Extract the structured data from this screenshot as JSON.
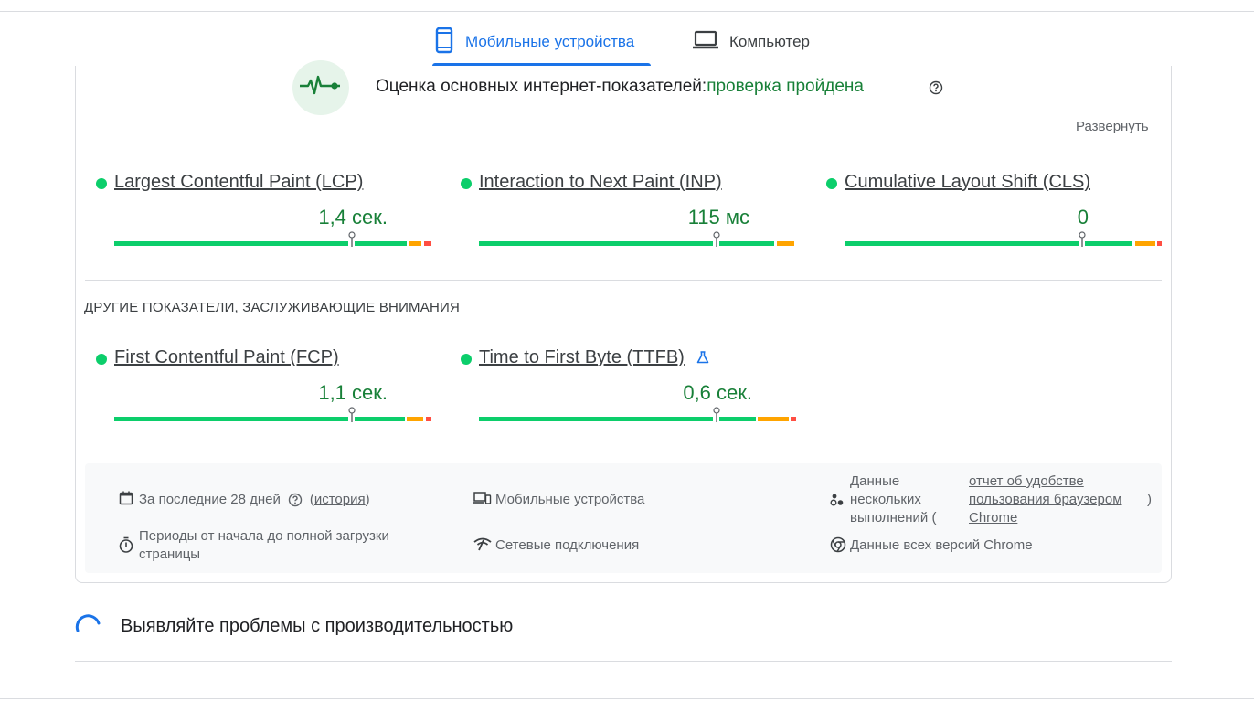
{
  "tabs": [
    {
      "label": "Мобильные устройства",
      "icon": "phone-icon",
      "active": true
    },
    {
      "label": "Компьютер",
      "icon": "laptop-icon",
      "active": false
    }
  ],
  "cwv": {
    "title_prefix": "Оценка основных интернет-показателей:",
    "status": "проверка пройдена",
    "expand_label": "Развернуть",
    "status_color": "#188038"
  },
  "core_metrics": [
    {
      "name": "Largest Contentful Paint (LCP)",
      "value": "1,4 сек."
    },
    {
      "name": "Interaction to Next Paint (INP)",
      "value": "115 мс"
    },
    {
      "name": "Cumulative Layout Shift (CLS)",
      "value": "0"
    }
  ],
  "other": {
    "title": "ДРУГИЕ ПОКАЗАТЕЛИ, ЗАСЛУЖИВАЮЩИЕ ВНИМАНИЯ",
    "metrics": [
      {
        "name": "First Contentful Paint (FCP)",
        "value": "1,1 сек."
      },
      {
        "name": "Time to First Byte (TTFB)",
        "value": "0,6 сек.",
        "experimental_icon": "flask-icon"
      }
    ]
  },
  "info": {
    "period_prefix": "За последние 28 дней",
    "history_open": "(",
    "history_link": "история",
    "history_close": ")",
    "devices": "Мобильные устройства",
    "samples_prefix": "Данные нескольких выполнений (",
    "samples_link": "отчет об удобстве пользования браузером Chrome",
    "samples_suffix": ")",
    "duration": "Периоды от начала до полной загрузки страницы",
    "network": "Сетевые подключения",
    "versions": "Данные всех версий Chrome"
  },
  "colors": {
    "good": "#0cce6b",
    "average": "#ffa400",
    "poor": "#ff4e42",
    "accent": "#1a73e8"
  },
  "diagnose": {
    "title": "Выявляйте проблемы с производительностью"
  }
}
